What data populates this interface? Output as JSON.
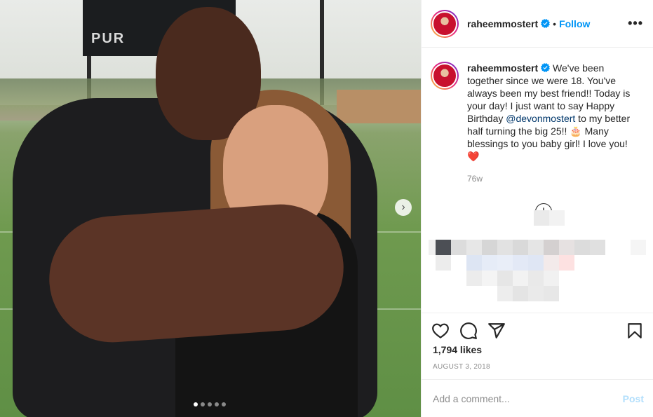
{
  "post": {
    "username": "raheemmostert",
    "follow_label": "Follow",
    "separator": "•",
    "more_icon": "more-horizontal-icon",
    "image_overlay_text": "PUR"
  },
  "caption": {
    "username": "raheemmostert",
    "text_part1": " We've been together since we were 18. You've always been my best friend!! Today is your day! I just want to say Happy Birthday ",
    "mention": "@devonmostert",
    "text_part2": " to my better half turning the big 25!! 🎂 Many blessings to you baby girl! I love you! ❤️",
    "time_ago": "76w"
  },
  "carousel": {
    "next_label": "›",
    "count": 5,
    "active_index": 0
  },
  "actions": {
    "like_icon": "heart-icon",
    "comment_icon": "comment-icon",
    "share_icon": "share-icon",
    "save_icon": "bookmark-icon"
  },
  "likes": "1,794 likes",
  "date": "AUGUST 3, 2018",
  "comment": {
    "placeholder": "Add a comment...",
    "post_label": "Post"
  },
  "load_more_label": "+",
  "colors": {
    "link": "#0095f6",
    "mention": "#00376b",
    "muted": "#8e8e8e",
    "post_disabled": "#b2dffc"
  }
}
